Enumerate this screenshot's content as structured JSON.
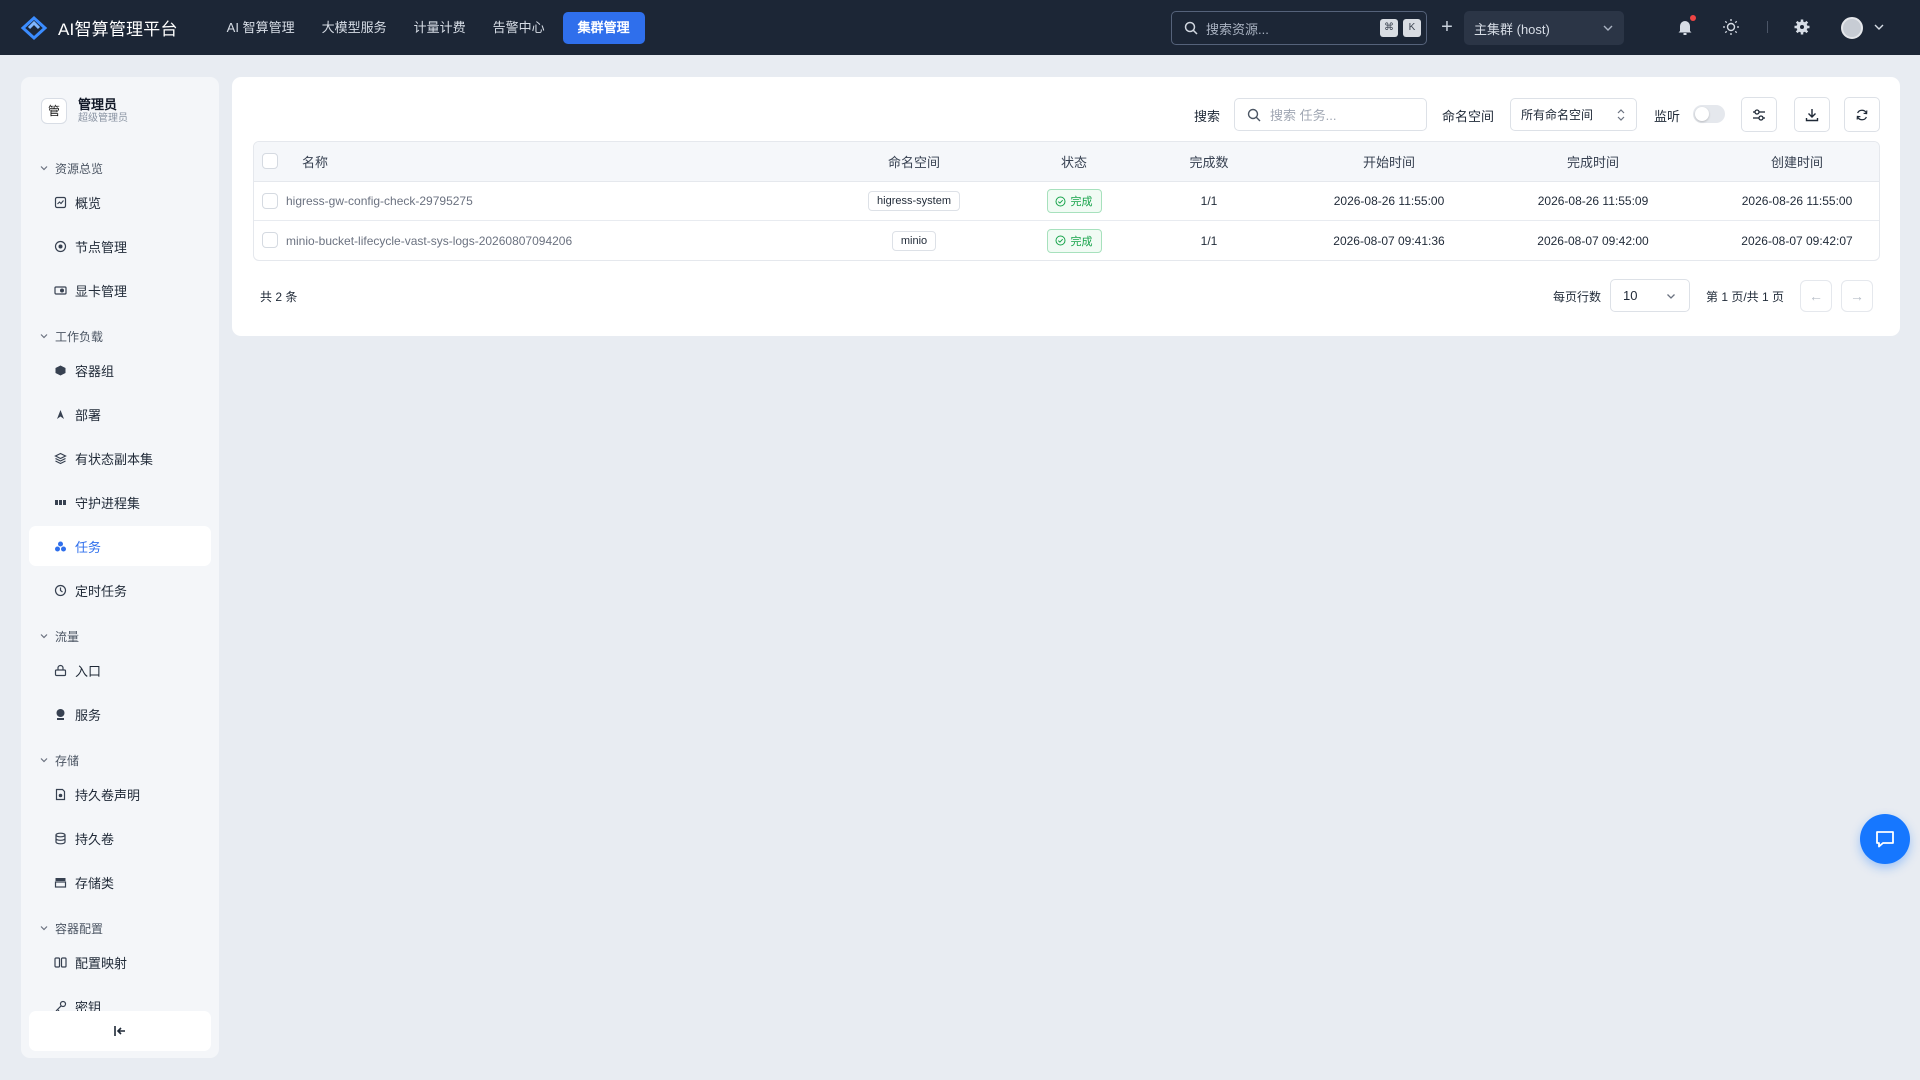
{
  "brand": {
    "name": "AI智算管理平台"
  },
  "topnav": [
    {
      "label": "AI 智算管理",
      "active": false
    },
    {
      "label": "大模型服务",
      "active": false
    },
    {
      "label": "计量计费",
      "active": false
    },
    {
      "label": "告警中心",
      "active": false
    },
    {
      "label": "集群管理",
      "active": true
    }
  ],
  "global_search": {
    "placeholder": "搜索资源...",
    "kbd1": "⌘",
    "kbd2": "K"
  },
  "cluster": {
    "selected": "主集群 (host)"
  },
  "user": {
    "avatar_char": "管",
    "name": "管理员",
    "role": "超级管理员"
  },
  "sidebar": {
    "groups": [
      {
        "label": "资源总览",
        "items": [
          {
            "label": "概览",
            "icon": "dashboard-icon"
          },
          {
            "label": "节点管理",
            "icon": "node-icon"
          },
          {
            "label": "显卡管理",
            "icon": "gpu-icon"
          }
        ]
      },
      {
        "label": "工作负载",
        "items": [
          {
            "label": "容器组",
            "icon": "pod-icon"
          },
          {
            "label": "部署",
            "icon": "deploy-icon"
          },
          {
            "label": "有状态副本集",
            "icon": "statefulset-icon"
          },
          {
            "label": "守护进程集",
            "icon": "daemonset-icon"
          },
          {
            "label": "任务",
            "icon": "job-icon",
            "active": true
          },
          {
            "label": "定时任务",
            "icon": "clock-icon"
          }
        ]
      },
      {
        "label": "流量",
        "items": [
          {
            "label": "入口",
            "icon": "ingress-icon"
          },
          {
            "label": "服务",
            "icon": "service-icon"
          }
        ]
      },
      {
        "label": "存储",
        "items": [
          {
            "label": "持久卷声明",
            "icon": "pvc-icon"
          },
          {
            "label": "持久卷",
            "icon": "pv-icon"
          },
          {
            "label": "存储类",
            "icon": "storageclass-icon"
          }
        ]
      },
      {
        "label": "容器配置",
        "items": [
          {
            "label": "配置映射",
            "icon": "configmap-icon"
          },
          {
            "label": "密钥",
            "icon": "key-icon"
          }
        ]
      }
    ]
  },
  "toolbar": {
    "search_label": "搜索",
    "search_placeholder": "搜索 任务...",
    "namespace_label": "命名空间",
    "namespace_selected": "所有命名空间",
    "watch_label": "监听",
    "watch_on": false
  },
  "table": {
    "columns": [
      "名称",
      "命名空间",
      "状态",
      "完成数",
      "开始时间",
      "完成时间",
      "创建时间"
    ],
    "rows": [
      {
        "name": "higress-gw-config-check-29795275",
        "namespace": "higress-system",
        "status": "完成",
        "completions": "1/1",
        "start": "2026-08-26 11:55:00",
        "finish": "2026-08-26 11:55:09",
        "created": "2026-08-26 11:55:00"
      },
      {
        "name": "minio-bucket-lifecycle-vast-sys-logs-20260807094206",
        "namespace": "minio",
        "status": "完成",
        "completions": "1/1",
        "start": "2026-08-07 09:41:36",
        "finish": "2026-08-07 09:42:00",
        "created": "2026-08-07 09:42:07"
      }
    ]
  },
  "pagination": {
    "total": "共 2 条",
    "rows_per_page_label": "每页行数",
    "rows_per_page": "10",
    "page_info": "第 1 页/共 1 页",
    "prev": "←",
    "next": "→"
  },
  "colors": {
    "topbar": "#1c2636",
    "accent": "#2f6fec",
    "success": "#16a34a",
    "fab": "#1677ff"
  }
}
